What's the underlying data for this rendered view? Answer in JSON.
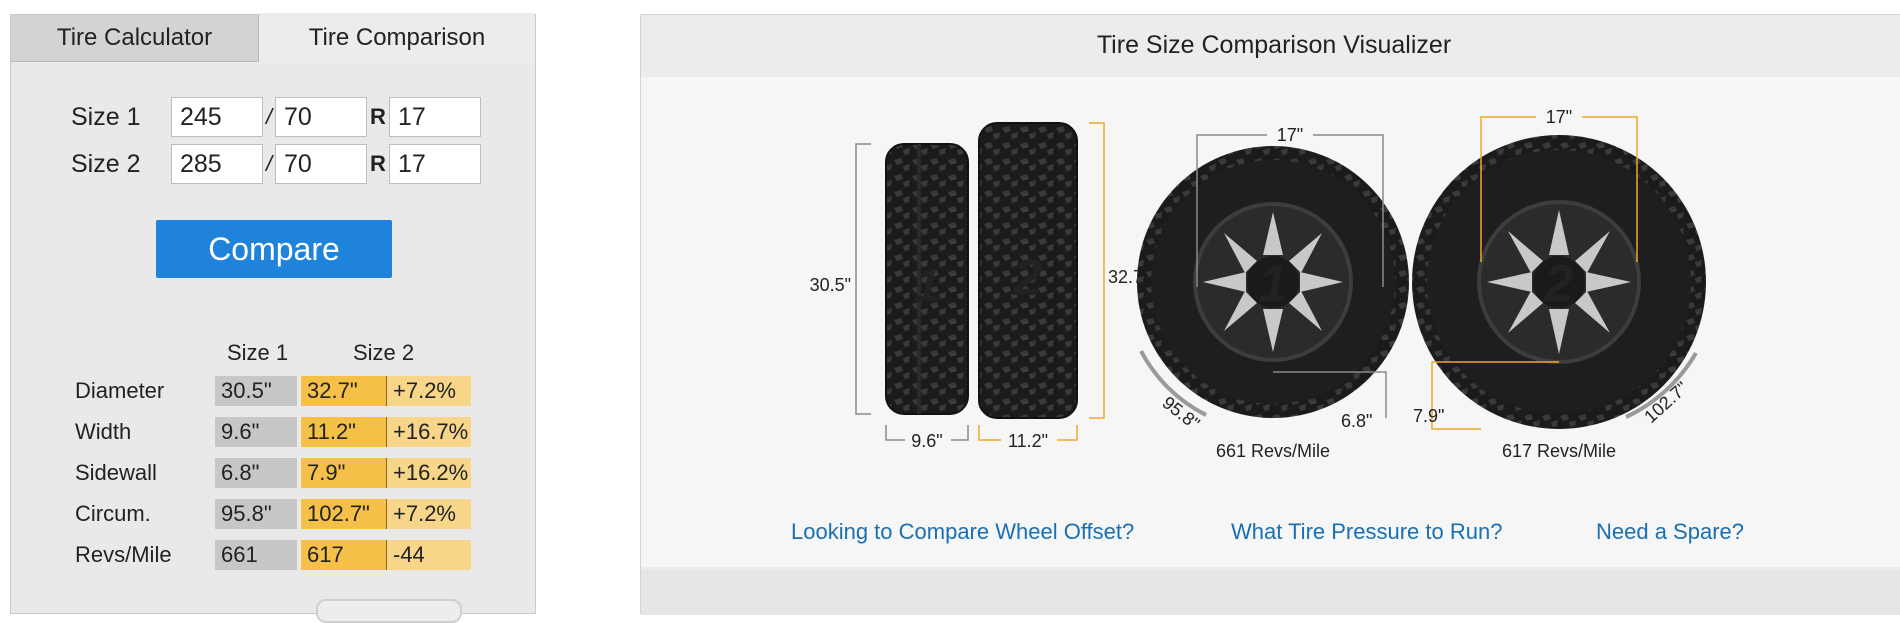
{
  "tabs": {
    "calculator": "Tire Calculator",
    "comparison": "Tire Comparison"
  },
  "inputs": {
    "size1_label": "Size 1",
    "size2_label": "Size 2",
    "slash": "/",
    "r": "R",
    "size1": {
      "width": "245",
      "aspect": "70",
      "rim": "17"
    },
    "size2": {
      "width": "285",
      "aspect": "70",
      "rim": "17"
    }
  },
  "compare_button": "Compare",
  "results": {
    "header_size1": "Size 1",
    "header_size2": "Size 2",
    "rows": [
      {
        "label": "Diameter",
        "size1": "30.5\"",
        "size2": "32.7\"",
        "diff": "+7.2%"
      },
      {
        "label": "Width",
        "size1": "9.6\"",
        "size2": "11.2\"",
        "diff": "+16.7%"
      },
      {
        "label": "Sidewall",
        "size1": "6.8\"",
        "size2": "7.9\"",
        "diff": "+16.2%"
      },
      {
        "label": "Circum.",
        "size1": "95.8\"",
        "size2": "102.7\"",
        "diff": "+7.2%"
      },
      {
        "label": "Revs/Mile",
        "size1": "661",
        "size2": "617",
        "diff": "-44"
      }
    ]
  },
  "visualizer": {
    "title": "Tire Size Comparison Visualizer",
    "tire1": {
      "number": "1",
      "diameter": "30.5\"",
      "width": "9.6\"",
      "rim": "17\"",
      "sidewall": "6.8\"",
      "circumference": "95.8\"",
      "revs": "661 Revs/Mile"
    },
    "tire2": {
      "number": "2",
      "diameter": "32.7\"",
      "width": "11.2\"",
      "rim": "17\"",
      "sidewall": "7.9\"",
      "circumference": "102.7\"",
      "revs": "617 Revs/Mile"
    },
    "colors": {
      "tire1_dim": "#8a8a8a",
      "tire2_dim": "#f0a72a",
      "tire": "#1b1b1b",
      "spoke": "#c8c8c8"
    }
  },
  "links": {
    "wheel_offset": "Looking to Compare Wheel Offset?",
    "tire_pressure": "What Tire Pressure to Run?",
    "spare": "Need a Spare?"
  }
}
